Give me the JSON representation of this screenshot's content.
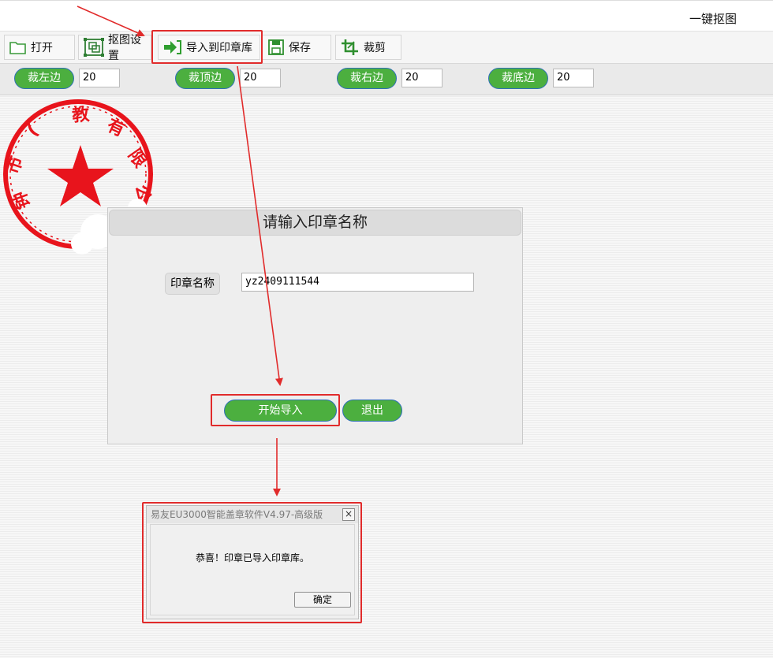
{
  "app": {
    "title": "一键抠图"
  },
  "toolbar": {
    "open_label": "打开",
    "matting_settings_label": "抠图设置",
    "import_label": "导入到印章库",
    "save_label": "保存",
    "crop_label": "裁剪"
  },
  "crop": {
    "left_label": "裁左边",
    "left_value": "20",
    "top_label": "裁顶边",
    "top_value": "20",
    "right_label": "裁右边",
    "right_value": "20",
    "bottom_label": "裁底边",
    "bottom_value": "20"
  },
  "stamp": {
    "ring_text": "市……教……有限公司",
    "color": "#e8141c"
  },
  "dialog": {
    "title": "请输入印章名称",
    "field_label": "印章名称",
    "field_value": "yz2409111544",
    "start_label": "开始导入",
    "exit_label": "退出"
  },
  "msgbox": {
    "title": "易友EU3000智能盖章软件V4.97-高级版",
    "close_icon": "×",
    "message": "恭喜！印章已导入印章库。",
    "ok_label": "确定"
  },
  "colors": {
    "accent_green": "#4caf3f",
    "button_border": "#2f6fb8",
    "annotation_red": "#e12b2b"
  }
}
